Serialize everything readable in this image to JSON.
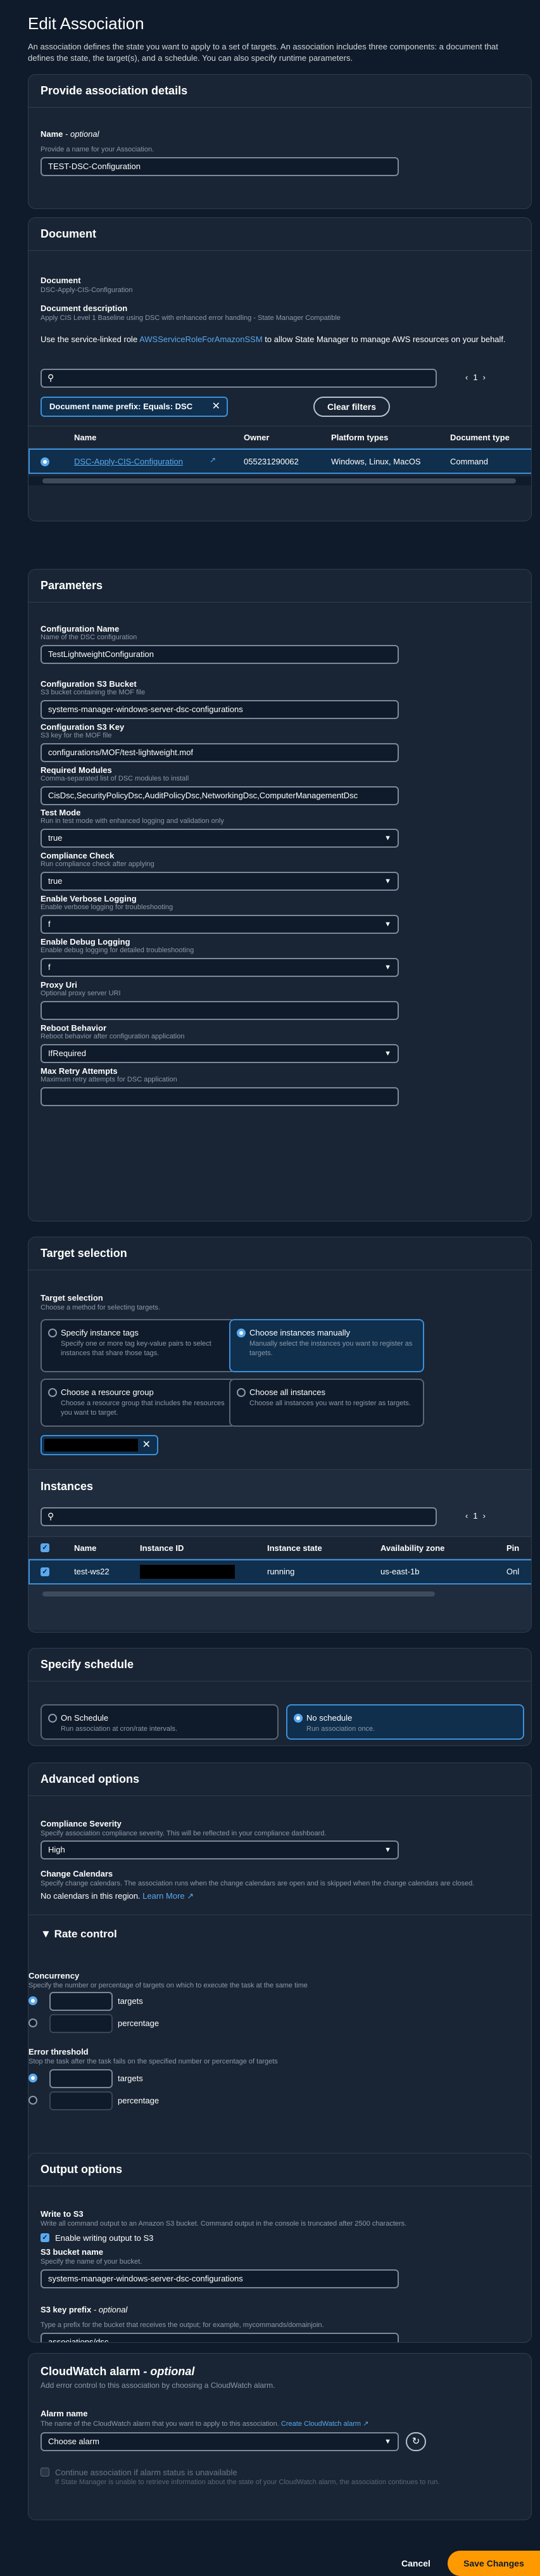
{
  "header": {
    "title": "Edit Association",
    "description": "An association defines the state you want to apply to a set of targets. An association includes three components: a document that defines the state, the target(s), and a schedule. You can also specify runtime parameters."
  },
  "details": {
    "title": "Provide association details",
    "name_label": "Name",
    "name_optional": "- optional",
    "name_desc": "Provide a name for your Association.",
    "name_value": "TEST-DSC-Configuration"
  },
  "document": {
    "title": "Document",
    "doc_label": "Document",
    "doc_value": "DSC-Apply-CIS-Configuration",
    "desc_label": "Document description",
    "desc_value": "Apply CIS Level 1 Baseline using DSC with enhanced error handling - State Manager Compatible",
    "role_text_1": "Use the service-linked role",
    "role_link": "AWSServiceRoleForAmazonSSM",
    "role_text_2": "to allow State Manager to manage AWS resources on your behalf.",
    "page": "1",
    "filter_token": "Document name prefix: Equals: DSC",
    "clear_filters": "Clear filters",
    "columns": [
      "Name",
      "Owner",
      "Platform types",
      "Document type"
    ],
    "row": {
      "name": "DSC-Apply-CIS-Configuration",
      "owner": "055231290062",
      "platforms": "Windows, Linux, MacOS",
      "type": "Command"
    }
  },
  "parameters": {
    "title": "Parameters",
    "fields": [
      {
        "label": "Configuration Name",
        "desc": "Name of the DSC configuration",
        "value": "TestLightweightConfiguration"
      },
      {
        "label": "Configuration S3 Bucket",
        "desc": "S3 bucket containing the MOF file",
        "value": "systems-manager-windows-server-dsc-configurations"
      },
      {
        "label": "Configuration S3 Key",
        "desc": "S3 key for the MOF file",
        "value": "configurations/MOF/test-lightweight.mof"
      },
      {
        "label": "Required Modules",
        "desc": "Comma-separated list of DSC modules to install",
        "value": "CisDsc,SecurityPolicyDsc,AuditPolicyDsc,NetworkingDsc,ComputerManagementDsc"
      },
      {
        "label": "Test Mode",
        "desc": "Run in test mode with enhanced logging and validation only",
        "value": "true"
      },
      {
        "label": "Compliance Check",
        "desc": "Run compliance check after applying",
        "value": "true"
      },
      {
        "label": "Enable Verbose Logging",
        "desc": "Enable verbose logging for troubleshooting",
        "value": "f"
      },
      {
        "label": "Enable Debug Logging",
        "desc": "Enable debug logging for detailed troubleshooting",
        "value": "f"
      },
      {
        "label": "Proxy Uri",
        "desc": "Optional proxy server URI",
        "value": ""
      },
      {
        "label": "Reboot Behavior",
        "desc": "Reboot behavior after configuration application",
        "value": "IfRequired"
      },
      {
        "label": "Max Retry Attempts",
        "desc": "Maximum retry attempts for DSC application",
        "value": ""
      }
    ]
  },
  "targets": {
    "title": "Target selection",
    "sel_label": "Target selection",
    "sel_desc": "Choose a method for selecting targets.",
    "tiles": [
      {
        "title": "Specify instance tags",
        "desc": "Specify one or more tag key-value pairs to select instances that share those tags."
      },
      {
        "title": "Choose instances manually",
        "desc": "Manually select the instances you want to register as targets."
      },
      {
        "title": "Choose a resource group",
        "desc": "Choose a resource group that includes the resources you want to target."
      },
      {
        "title": "Choose all instances",
        "desc": "Choose all instances you want to register as targets."
      }
    ],
    "instances_title": "Instances",
    "page": "1",
    "columns": [
      "Name",
      "Instance ID",
      "Instance state",
      "Availability zone",
      "Pin"
    ],
    "row": {
      "name": "test-ws22",
      "state": "running",
      "az": "us-east-1b",
      "extra": "Onl"
    }
  },
  "schedule": {
    "title": "Specify schedule",
    "opt1": "On Schedule",
    "opt1_desc": "Run association at cron/rate intervals.",
    "opt2": "No schedule",
    "opt2_desc": "Run association once."
  },
  "advanced": {
    "title": "Advanced options",
    "sev_label": "Compliance Severity",
    "sev_desc": "Specify association compliance severity. This will be reflected in your compliance dashboard.",
    "sev_value": "High",
    "cal_label": "Change Calendars",
    "cal_desc": "Specify change calendars. The association runs when the change calendars are open and is skipped when the change calendars are closed.",
    "cal_none": "No calendars in this region.",
    "cal_link": "Learn More"
  },
  "rate": {
    "title": "Rate control",
    "conc_label": "Concurrency",
    "conc_desc": "Specify the number or percentage of targets on which to execute the task at the same time",
    "targets": "targets",
    "percentage": "percentage",
    "err_label": "Error threshold",
    "err_desc": "Stop the task after the task fails on the specified number or percentage of targets"
  },
  "output": {
    "title": "Output options",
    "write_label": "Write to S3",
    "write_desc": "Write all command output to an Amazon S3 bucket. Command output in the console is truncated after 2500 characters.",
    "enable": "Enable writing output to S3",
    "bucket_label": "S3 bucket name",
    "bucket_desc": "Specify the name of your bucket.",
    "bucket_value": "systems-manager-windows-server-dsc-configurations",
    "prefix_label": "S3 key prefix",
    "prefix_optional": "- optional",
    "prefix_desc": "Type a prefix for the bucket that receives the output; for example, mycommands/domainjoin.",
    "prefix_value": "associations/dsc"
  },
  "alarm": {
    "title": "CloudWatch alarm",
    "title_optional": "- optional",
    "desc": "Add error control to this association by choosing a CloudWatch alarm.",
    "name_label": "Alarm name",
    "name_desc": "The name of the CloudWatch alarm that you want to apply to this association.",
    "create_link": "Create CloudWatch alarm",
    "select": "Choose alarm",
    "cont": "Continue association if alarm status is unavailable",
    "cont_desc": "If State Manager is unable to retrieve information about the state of your CloudWatch alarm, the association continues to run."
  },
  "footer": {
    "cancel": "Cancel",
    "save": "Save Changes"
  }
}
